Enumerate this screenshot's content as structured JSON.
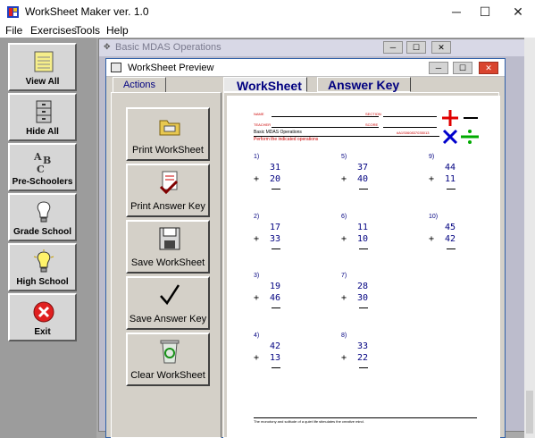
{
  "app": {
    "title": "WorkSheet Maker ver. 1.0"
  },
  "window_controls": {
    "minimize": "─",
    "maximize": "☐",
    "close": "✕"
  },
  "menu": [
    "File",
    "Exercises",
    "Tools",
    "Help"
  ],
  "leftbar": [
    {
      "label": "View All",
      "icon": "notepad-icon"
    },
    {
      "label": "Hide All",
      "icon": "file-cabinet-icon"
    },
    {
      "label": "Pre-Schoolers",
      "icon": "abc-blocks-icon"
    },
    {
      "label": "Grade School",
      "icon": "light-bulb-off-icon"
    },
    {
      "label": "High School",
      "icon": "light-bulb-on-icon"
    },
    {
      "label": "Exit",
      "icon": "exit-x-icon"
    }
  ],
  "background_window": {
    "title": "Basic MDAS Operations"
  },
  "preview_window": {
    "title": "WorkSheet Preview"
  },
  "actions_tab": "Actions",
  "actions": [
    {
      "label": "Print WorkSheet",
      "icon": "print-folder-icon"
    },
    {
      "label": "Print Answer Key",
      "icon": "print-key-icon"
    },
    {
      "label": "Save WorkSheet",
      "icon": "floppy-disk-icon"
    },
    {
      "label": "Save Answer Key",
      "icon": "checkmark-icon"
    },
    {
      "label": "Clear WorkSheet",
      "icon": "recycle-bin-icon"
    }
  ],
  "doc_tabs": {
    "worksheet": "WorkSheet",
    "answer_key": "Answer Key"
  },
  "worksheet": {
    "name_label": "NAME",
    "section_label": "SECTION",
    "teacher_label": "TEACHER",
    "score_label": "SCORE",
    "title": "Basic MDAS Operations",
    "code": "#A1S060837035013",
    "instructions": "Perform the indicated operations",
    "footer": "The monotony and solitude of a quiet life stimulates the creative mind.",
    "operator_symbols": {
      "plus": "+",
      "minus": "−",
      "times": "×",
      "divide": "÷"
    },
    "colors": {
      "plus": "#e00000",
      "minus": "#000000",
      "times": "#0000cc",
      "divide": "#00aa00"
    },
    "problems": [
      {
        "num": "1)",
        "a": "31",
        "op": "+",
        "b": "20"
      },
      {
        "num": "2)",
        "a": "17",
        "op": "+",
        "b": "33"
      },
      {
        "num": "3)",
        "a": "19",
        "op": "+",
        "b": "46"
      },
      {
        "num": "4)",
        "a": "42",
        "op": "+",
        "b": "13"
      },
      {
        "num": "5)",
        "a": "37",
        "op": "+",
        "b": "40"
      },
      {
        "num": "6)",
        "a": "11",
        "op": "+",
        "b": "10"
      },
      {
        "num": "7)",
        "a": "28",
        "op": "+",
        "b": "30"
      },
      {
        "num": "8)",
        "a": "33",
        "op": "+",
        "b": "22"
      },
      {
        "num": "9)",
        "a": "44",
        "op": "+",
        "b": "11"
      },
      {
        "num": "10)",
        "a": "45",
        "op": "+",
        "b": "42"
      }
    ]
  }
}
